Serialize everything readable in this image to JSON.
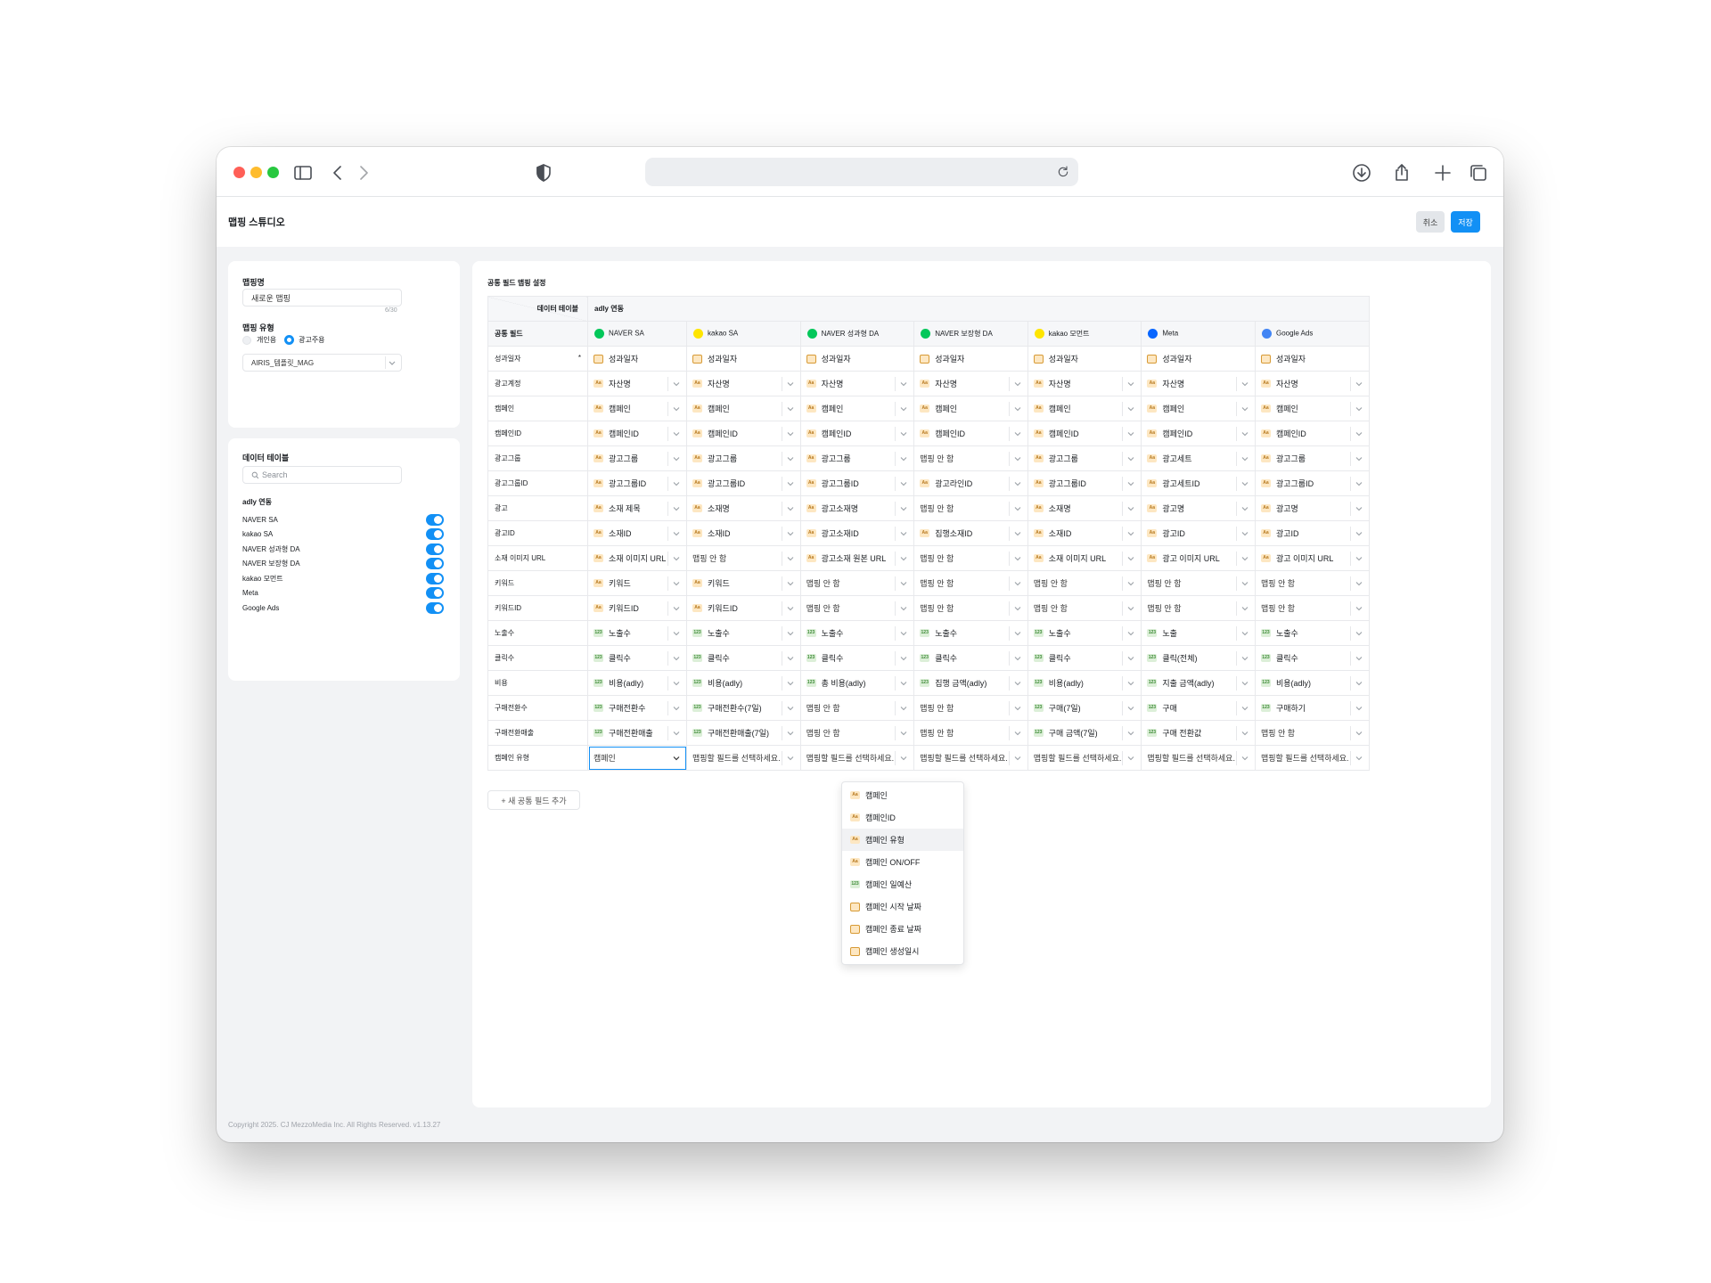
{
  "app": {
    "title": "맵핑 스튜디오",
    "cancel": "취소",
    "save": "저장",
    "copyright": "Copyright 2025. CJ MezzoMedia Inc. All Rights Reserved. v1.13.27"
  },
  "left": {
    "mapping_name_label": "맵핑명",
    "mapping_name_value": "새로운 맵핑",
    "char_count": "6/30",
    "mapping_type_label": "맵핑 유형",
    "type_personal": "개인용",
    "type_advertiser": "광고주용",
    "advertiser_select": "AIRIS_템플릿_MAG",
    "data_table_label": "데이터 테이블",
    "search_placeholder": "Search",
    "group_label": "adly 연동",
    "tables": [
      "NAVER SA",
      "kakao SA",
      "NAVER 성과형 DA",
      "NAVER 보장형 DA",
      "kakao 모먼트",
      "Meta",
      "Google Ads"
    ]
  },
  "main": {
    "section_title": "공통 필드 맵핑 설정",
    "data_table_header": "데이터 테이블",
    "group_header": "adly 연동",
    "common_field_header": "공통 필드",
    "platforms": [
      "NAVER SA",
      "kakao SA",
      "NAVER 성과형 DA",
      "NAVER 보장형 DA",
      "kakao 모먼트",
      "Meta",
      "Google Ads"
    ],
    "platform_colors": [
      "#03c75a",
      "#fee500",
      "#03c75a",
      "#03c75a",
      "#fee500",
      "#0866ff",
      "#4285f4"
    ],
    "add_button": "+ 새 공통 필드 추가",
    "rows": [
      {
        "label": "성과일자",
        "required": "*",
        "cells": [
          [
            "d",
            "성과일자"
          ],
          [
            "d",
            "성과일자"
          ],
          [
            "d",
            "성과일자"
          ],
          [
            "d",
            "성과일자"
          ],
          [
            "d",
            "성과일자"
          ],
          [
            "d",
            "성과일자"
          ],
          [
            "d",
            "성과일자"
          ]
        ]
      },
      {
        "label": "광고계정",
        "cells": [
          [
            "aa",
            "자산명"
          ],
          [
            "aa",
            "자산명"
          ],
          [
            "aa",
            "자산명"
          ],
          [
            "aa",
            "자산명"
          ],
          [
            "aa",
            "자산명"
          ],
          [
            "aa",
            "자산명"
          ],
          [
            "aa",
            "자산명"
          ]
        ]
      },
      {
        "label": "캠페인",
        "cells": [
          [
            "aa",
            "캠페인"
          ],
          [
            "aa",
            "캠페인"
          ],
          [
            "aa",
            "캠페인"
          ],
          [
            "aa",
            "캠페인"
          ],
          [
            "aa",
            "캠페인"
          ],
          [
            "aa",
            "캠페인"
          ],
          [
            "aa",
            "캠페인"
          ]
        ]
      },
      {
        "label": "캠페인ID",
        "cells": [
          [
            "aa",
            "캠페인ID"
          ],
          [
            "aa",
            "캠페인ID"
          ],
          [
            "aa",
            "캠페인ID"
          ],
          [
            "aa",
            "캠페인ID"
          ],
          [
            "aa",
            "캠페인ID"
          ],
          [
            "aa",
            "캠페인ID"
          ],
          [
            "aa",
            "캠페인ID"
          ]
        ]
      },
      {
        "label": "광고그룹",
        "cells": [
          [
            "aa",
            "광고그룹"
          ],
          [
            "aa",
            "광고그룹"
          ],
          [
            "aa",
            "광고그룹"
          ],
          [
            "",
            "맵핑 안 함"
          ],
          [
            "aa",
            "광고그룹"
          ],
          [
            "aa",
            "광고세트"
          ],
          [
            "aa",
            "광고그룹"
          ]
        ]
      },
      {
        "label": "광고그룹ID",
        "cells": [
          [
            "aa",
            "광고그룹ID"
          ],
          [
            "aa",
            "광고그룹ID"
          ],
          [
            "aa",
            "광고그룹ID"
          ],
          [
            "aa",
            "광고라인ID"
          ],
          [
            "aa",
            "광고그룹ID"
          ],
          [
            "aa",
            "광고세트ID"
          ],
          [
            "aa",
            "광고그룹ID"
          ]
        ]
      },
      {
        "label": "광고",
        "cells": [
          [
            "aa",
            "소재 제목"
          ],
          [
            "aa",
            "소재명"
          ],
          [
            "aa",
            "광고소재명"
          ],
          [
            "",
            "맵핑 안 함"
          ],
          [
            "aa",
            "소재명"
          ],
          [
            "aa",
            "광고명"
          ],
          [
            "aa",
            "광고명"
          ]
        ]
      },
      {
        "label": "광고ID",
        "cells": [
          [
            "aa",
            "소재ID"
          ],
          [
            "aa",
            "소재ID"
          ],
          [
            "aa",
            "광고소재ID"
          ],
          [
            "aa",
            "집행소재ID"
          ],
          [
            "aa",
            "소재ID"
          ],
          [
            "aa",
            "광고ID"
          ],
          [
            "aa",
            "광고ID"
          ]
        ]
      },
      {
        "label": "소재 이미지 URL",
        "cells": [
          [
            "aa",
            "소재 이미지 URL"
          ],
          [
            "",
            "맵핑 안 함"
          ],
          [
            "aa",
            "광고소재 원본 URL"
          ],
          [
            "",
            "맵핑 안 함"
          ],
          [
            "aa",
            "소재 이미지 URL"
          ],
          [
            "aa",
            "광고 이미지 URL"
          ],
          [
            "aa",
            "광고 이미지 URL"
          ]
        ]
      },
      {
        "label": "키워드",
        "cells": [
          [
            "aa",
            "키워드"
          ],
          [
            "aa",
            "키워드"
          ],
          [
            "",
            "맵핑 안 함"
          ],
          [
            "",
            "맵핑 안 함"
          ],
          [
            "",
            "맵핑 안 함"
          ],
          [
            "",
            "맵핑 안 함"
          ],
          [
            "",
            "맵핑 안 함"
          ]
        ]
      },
      {
        "label": "키워드ID",
        "cells": [
          [
            "aa",
            "키워드ID"
          ],
          [
            "aa",
            "키워드ID"
          ],
          [
            "",
            "맵핑 안 함"
          ],
          [
            "",
            "맵핑 안 함"
          ],
          [
            "",
            "맵핑 안 함"
          ],
          [
            "",
            "맵핑 안 함"
          ],
          [
            "",
            "맵핑 안 함"
          ]
        ]
      },
      {
        "label": "노출수",
        "cells": [
          [
            "n",
            "노출수"
          ],
          [
            "n",
            "노출수"
          ],
          [
            "n",
            "노출수"
          ],
          [
            "n",
            "노출수"
          ],
          [
            "n",
            "노출수"
          ],
          [
            "n",
            "노출"
          ],
          [
            "n",
            "노출수"
          ]
        ]
      },
      {
        "label": "클릭수",
        "cells": [
          [
            "n",
            "클릭수"
          ],
          [
            "n",
            "클릭수"
          ],
          [
            "n",
            "클릭수"
          ],
          [
            "n",
            "클릭수"
          ],
          [
            "n",
            "클릭수"
          ],
          [
            "n",
            "클릭(전체)"
          ],
          [
            "n",
            "클릭수"
          ]
        ]
      },
      {
        "label": "비용",
        "cells": [
          [
            "n",
            "비용(adly)"
          ],
          [
            "n",
            "비용(adly)"
          ],
          [
            "n",
            "총 비용(adly)"
          ],
          [
            "n",
            "집행 금액(adly)"
          ],
          [
            "n",
            "비용(adly)"
          ],
          [
            "n",
            "지출 금액(adly)"
          ],
          [
            "n",
            "비용(adly)"
          ]
        ]
      },
      {
        "label": "구매전환수",
        "cells": [
          [
            "n",
            "구매전환수"
          ],
          [
            "n",
            "구매전환수(7일)"
          ],
          [
            "",
            "맵핑 안 함"
          ],
          [
            "",
            "맵핑 안 함"
          ],
          [
            "n",
            "구매(7일)"
          ],
          [
            "n",
            "구매"
          ],
          [
            "n",
            "구매하기"
          ]
        ]
      },
      {
        "label": "구매전환매출",
        "cells": [
          [
            "n",
            "구매전환매출"
          ],
          [
            "n",
            "구매전환매출(7일)"
          ],
          [
            "",
            "맵핑 안 함"
          ],
          [
            "",
            "맵핑 안 함"
          ],
          [
            "n",
            "구매 금액(7일)"
          ],
          [
            "n",
            "구매 전환값"
          ],
          [
            "",
            "맵핑 안 함"
          ]
        ]
      },
      {
        "label": "캠페인 유형",
        "cells": [
          [
            "",
            "캠페인"
          ],
          [
            "",
            "맵핑할 필드를 선택하세요."
          ],
          [
            "",
            "맵핑할 필드를 선택하세요."
          ],
          [
            "",
            "맵핑할 필드를 선택하세요."
          ],
          [
            "",
            "맵핑할 필드를 선택하세요."
          ],
          [
            "",
            "맵핑할 필드를 선택하세요."
          ],
          [
            "",
            "맵핑할 필드를 선택하세요."
          ]
        ]
      }
    ],
    "tag_labels": {
      "aa": "Aa",
      "n": "123",
      "d": ""
    },
    "dropdown": [
      [
        "aa",
        "캠페인"
      ],
      [
        "aa",
        "캠페인ID"
      ],
      [
        "aa",
        "캠페인 유형"
      ],
      [
        "aa",
        "캠페인 ON/OFF"
      ],
      [
        "n",
        "캠페인 일예산"
      ],
      [
        "d",
        "캠페인 시작 날짜"
      ],
      [
        "d",
        "캠페인 종료 날짜"
      ],
      [
        "d",
        "캠페인 생성일시"
      ]
    ]
  }
}
